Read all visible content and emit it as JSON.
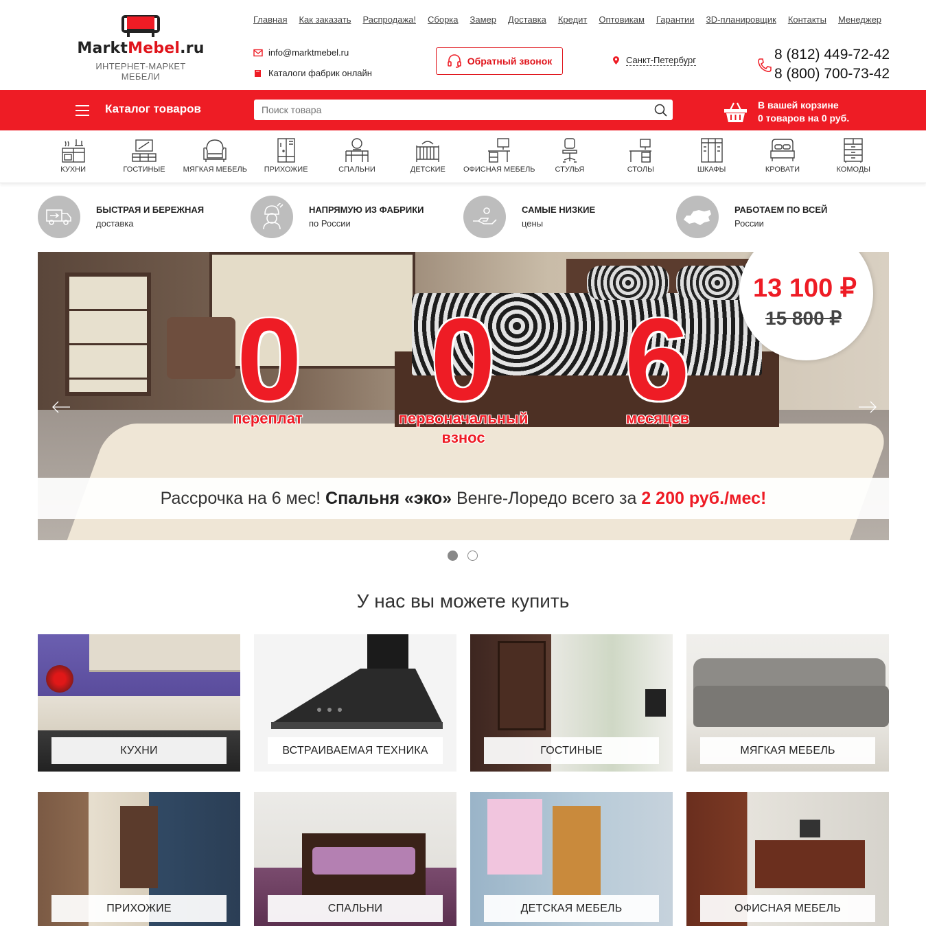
{
  "logo": {
    "brand_part1": "Markt",
    "brand_part2": "Mebel",
    "brand_part3": ".ru",
    "tagline": "ИНТЕРНЕТ-МАРКЕТ МЕБЕЛИ"
  },
  "topnav": [
    "Главная",
    "Как заказать",
    "Распродажа!",
    "Сборка",
    "Замер",
    "Доставка",
    "Кредит",
    "Оптовикам",
    "Гарантии",
    "3D-планировщик",
    "Контакты",
    "Менеджер"
  ],
  "contacts": {
    "email": "info@marktmebel.ru",
    "catalogs": "Каталоги фабрик онлайн",
    "callback": "Обратный звонок",
    "city": "Санкт-Петербург",
    "phone1": "8 (812) 449-72-42",
    "phone2": "8 (800) 700-73-42"
  },
  "redbar": {
    "catalog": "Каталог товаров",
    "search_placeholder": "Поиск товара",
    "cart_line1": "В вашей корзине",
    "cart_line2": "0 товаров на 0 руб."
  },
  "categories": [
    {
      "label": "КУХНИ",
      "icon": "kitchen-icon"
    },
    {
      "label": "ГОСТИНЫЕ",
      "icon": "tv-stand-icon"
    },
    {
      "label": "МЯГКАЯ МЕБЕЛЬ",
      "icon": "armchair-icon"
    },
    {
      "label": "ПРИХОЖИЕ",
      "icon": "hallway-icon"
    },
    {
      "label": "СПАЛЬНИ",
      "icon": "dresser-icon"
    },
    {
      "label": "ДЕТСКИЕ",
      "icon": "crib-icon"
    },
    {
      "label": "ОФИСНАЯ МЕБЕЛЬ",
      "icon": "office-desk-icon"
    },
    {
      "label": "СТУЛЬЯ",
      "icon": "chair-icon"
    },
    {
      "label": "СТОЛЫ",
      "icon": "desk-icon"
    },
    {
      "label": "ШКАФЫ",
      "icon": "wardrobe-icon"
    },
    {
      "label": "КРОВАТИ",
      "icon": "bed-icon"
    },
    {
      "label": "КОМОДЫ",
      "icon": "chest-icon"
    }
  ],
  "advantages": [
    {
      "title": "БЫСТРАЯ И БЕРЕЖНАЯ",
      "sub": "доставка",
      "icon": "truck-icon"
    },
    {
      "title": "НАПРЯМУЮ ИЗ ФАБРИКИ",
      "sub": "по России",
      "icon": "worker-icon"
    },
    {
      "title": "САМЫЕ НИЗКИЕ",
      "sub": "цены",
      "icon": "hand-coin-icon"
    },
    {
      "title": "РАБОТАЕМ ПО ВСЕЙ",
      "sub": "России",
      "icon": "russia-map-icon"
    }
  ],
  "slider": {
    "digits": [
      "0",
      "0",
      "6"
    ],
    "captions": [
      "переплат",
      "первоначальный взнос",
      "месяцев"
    ],
    "price_new": "13 100 ₽",
    "price_old": "15 800 ₽",
    "banner_part1": "Рассрочка на 6 мес! ",
    "banner_part2": "Спальня «эко»",
    "banner_part3": " Венге-Лоредо всего за ",
    "banner_part4": "2 200 руб./мес!",
    "active_slide": 1,
    "slide_count": 2
  },
  "section_title": "У нас вы можете купить",
  "tiles": [
    "КУХНИ",
    "ВСТРАИВАЕМАЯ ТЕХНИКА",
    "ГОСТИНЫЕ",
    "МЯГКАЯ МЕБЕЛЬ",
    "ПРИХОЖИЕ",
    "СПАЛЬНИ",
    "ДЕТСКАЯ МЕБЕЛЬ",
    "ОФИСНАЯ МЕБЕЛЬ"
  ],
  "colors": {
    "accent": "#ee1c25",
    "text": "#333333",
    "icon_gray": "#bdbdbd"
  }
}
